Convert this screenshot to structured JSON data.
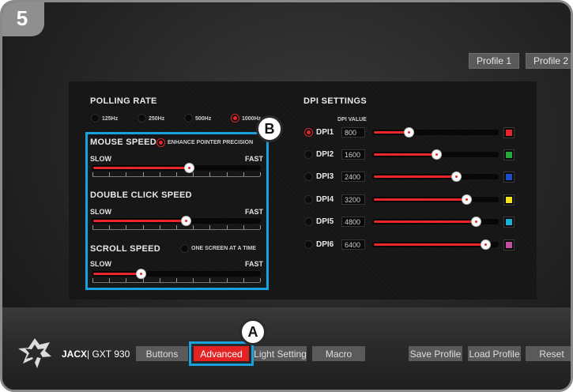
{
  "step_number": "5",
  "profiles": [
    "Profile 1",
    "Profile 2"
  ],
  "polling": {
    "title": "POLLING RATE",
    "options": [
      "125Hz",
      "250Hz",
      "500Hz",
      "1000Hz"
    ],
    "selected": "1000Hz"
  },
  "mouse_speed": {
    "title": "MOUSE SPEED",
    "checkbox_label": "ENHANCE POINTER PRECISION",
    "checkbox_on": true,
    "slow": "SLOW",
    "fast": "FAST",
    "value": 0.58
  },
  "double_click": {
    "title": "DOUBLE CLICK SPEED",
    "slow": "SLOW",
    "fast": "FAST",
    "value": 0.56
  },
  "scroll_speed": {
    "title": "SCROLL SPEED",
    "checkbox_label": "ONE SCREEN AT A TIME",
    "checkbox_on": false,
    "slow": "SLOW",
    "fast": "FAST",
    "value": 0.28
  },
  "dpi": {
    "title": "DPI SETTINGS",
    "value_header": "DPI VALUE",
    "levels": [
      {
        "label": "DPI1",
        "value": "800",
        "fraction": 0.27,
        "color": "#e8232b",
        "selected": true
      },
      {
        "label": "DPI2",
        "value": "1600",
        "fraction": 0.51,
        "color": "#26a83a",
        "selected": false
      },
      {
        "label": "DPI3",
        "value": "2400",
        "fraction": 0.68,
        "color": "#1e4fc8",
        "selected": false
      },
      {
        "label": "DPI4",
        "value": "3200",
        "fraction": 0.77,
        "color": "#f1e31c",
        "selected": false
      },
      {
        "label": "DPI5",
        "value": "4800",
        "fraction": 0.85,
        "color": "#1ab0d8",
        "selected": false
      },
      {
        "label": "DPI6",
        "value": "6400",
        "fraction": 0.93,
        "color": "#c04f9e",
        "selected": false
      }
    ]
  },
  "callouts": {
    "a": "A",
    "b": "B"
  },
  "brand": {
    "name": "JACX",
    "model": "| GXT 930"
  },
  "tabs": [
    "Buttons",
    "Advanced",
    "Light Setting",
    "Macro"
  ],
  "active_tab": "Advanced",
  "actions": [
    "Save Profile",
    "Load Profile",
    "Reset"
  ],
  "colors": {
    "accent": "#e32323",
    "highlight": "#1aa0dc"
  }
}
